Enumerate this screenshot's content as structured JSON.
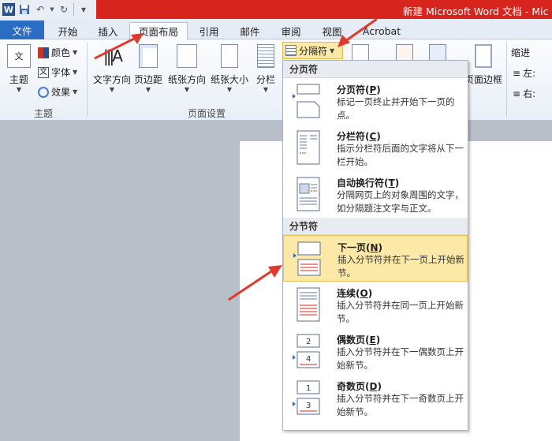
{
  "window": {
    "title": "新建 Microsoft Word 文档 - Mic",
    "logo": "W"
  },
  "tabs": [
    {
      "label": "文件"
    },
    {
      "label": "开始"
    },
    {
      "label": "插入"
    },
    {
      "label": "页面布局"
    },
    {
      "label": "引用"
    },
    {
      "label": "邮件"
    },
    {
      "label": "审阅"
    },
    {
      "label": "视图"
    },
    {
      "label": "Acrobat"
    }
  ],
  "ribbon": {
    "theme_group": {
      "label": "主题",
      "theme_button": "主题",
      "colors": "颜色",
      "fonts": "字体",
      "effects": "效果"
    },
    "page_setup_group": {
      "label": "页面设置",
      "text_direction": "文字方向",
      "margins": "页边距",
      "orientation": "纸张方向",
      "size": "纸张大小",
      "columns": "分栏",
      "breaks": "分隔符"
    },
    "right": {
      "page_borders": "页面边框",
      "indent": "缩进",
      "left": "左:",
      "right": "右:"
    }
  },
  "menu": {
    "page_breaks_header": "分页符",
    "section_breaks_header": "分节符",
    "items": [
      {
        "title": "分页符(",
        "key": "P",
        "end": ")",
        "desc": "标记一页终止并开始下一页的点。"
      },
      {
        "title": "分栏符(",
        "key": "C",
        "end": ")",
        "desc": "指示分栏符后面的文字将从下一栏开始。"
      },
      {
        "title": "自动换行符(",
        "key": "T",
        "end": ")",
        "desc": "分隔网页上的对象周围的文字，如分隔题注文字与正文。"
      },
      {
        "title": "下一页(",
        "key": "N",
        "end": ")",
        "desc": "插入分节符并在下一页上开始新节。"
      },
      {
        "title": "连续(",
        "key": "O",
        "end": ")",
        "desc": "插入分节符并在同一页上开始新节。"
      },
      {
        "title": "偶数页(",
        "key": "E",
        "end": ")",
        "desc": "插入分节符并在下一偶数页上开始新节。"
      },
      {
        "title": "奇数页(",
        "key": "D",
        "end": ")",
        "desc": "插入分节符并在下一奇数页上开始新节。"
      }
    ]
  },
  "colors": {
    "title_bar": "#d7241d",
    "highlight": "#fce9a7",
    "file_tab": "#2b6cc4",
    "annotation_arrow": "#e03a2f"
  }
}
